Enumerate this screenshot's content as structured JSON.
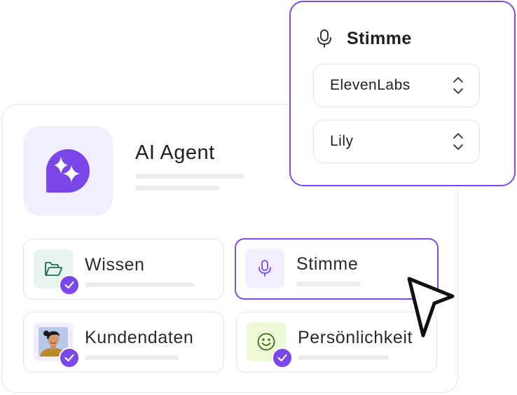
{
  "agent": {
    "title": "AI Agent",
    "avatar_icon": "sparkle-chat-icon",
    "accent": "#7b47e8"
  },
  "tiles": [
    {
      "label": "Wissen",
      "icon": "folder-icon",
      "checked": true,
      "selected": false
    },
    {
      "label": "Stimme",
      "icon": "microphone-icon",
      "checked": false,
      "selected": true
    },
    {
      "label": "Kundendaten",
      "icon": "customer-photo",
      "checked": true,
      "selected": false
    },
    {
      "label": "Persönlichkeit",
      "icon": "smiley-icon",
      "checked": true,
      "selected": false
    }
  ],
  "voice_panel": {
    "title": "Stimme",
    "icon": "microphone-icon",
    "provider": "ElevenLabs",
    "voice": "Lily"
  },
  "colors": {
    "accent": "#7c4ae8",
    "border": "#e4e4e4",
    "placeholder": "#ececec"
  }
}
